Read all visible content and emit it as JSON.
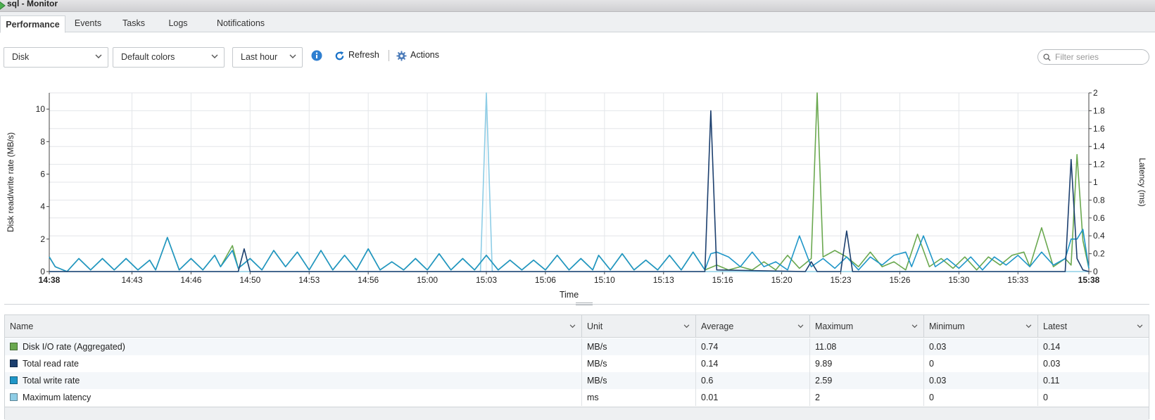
{
  "window": {
    "title": "sql - Monitor"
  },
  "tabs": [
    {
      "label": "Performance",
      "active": true
    },
    {
      "label": "Events"
    },
    {
      "label": "Tasks"
    },
    {
      "label": "Logs"
    },
    {
      "label": "Notifications"
    }
  ],
  "toolbar": {
    "metric_select": "Disk",
    "colors_select": "Default colors",
    "range_select": "Last hour",
    "refresh_label": "Refresh",
    "actions_label": "Actions",
    "filter_placeholder": "Filter series"
  },
  "colors": {
    "disk_io": "#6aa84f",
    "read": "#1c3f6e",
    "write": "#1f96c8",
    "latency": "#8ecde6",
    "accent": "#1a73c9"
  },
  "chart_data": {
    "type": "line",
    "xlabel": "Time",
    "ylabel_left": "Disk read/write rate (MB/s)",
    "ylabel_right": "Latency (ms)",
    "x_range_minutes": [
      0,
      60
    ],
    "y_left_range": [
      0,
      11
    ],
    "y_right_range": [
      0,
      2
    ],
    "y_left_ticks": [
      "0",
      "2",
      "4",
      "6",
      "8",
      "10"
    ],
    "y_right_ticks": [
      "0",
      "0.2",
      "0.4",
      "0.6",
      "0.8",
      "1",
      "1.2",
      "1.4",
      "1.6",
      "1.8",
      "2"
    ],
    "x_ticks": [
      {
        "t": 0,
        "label": "14:38",
        "bold": true
      },
      {
        "t": 7,
        "label": "14:43"
      },
      {
        "t": 12,
        "label": "14:46"
      },
      {
        "t": 17,
        "label": "14:50"
      },
      {
        "t": 22,
        "label": "14:53"
      },
      {
        "t": 27,
        "label": "14:56"
      },
      {
        "t": 32,
        "label": "15:00"
      },
      {
        "t": 37,
        "label": "15:03"
      },
      {
        "t": 42,
        "label": "15:06"
      },
      {
        "t": 47,
        "label": "15:10"
      },
      {
        "t": 52,
        "label": "15:13"
      },
      {
        "t": 57,
        "label": "15:16"
      },
      {
        "t": 62,
        "label": "15:20"
      },
      {
        "t": 67,
        "label": "15:23"
      },
      {
        "t": 72,
        "label": "15:26"
      },
      {
        "t": 77,
        "label": "15:30"
      },
      {
        "t": 82,
        "label": "15:33"
      },
      {
        "t": 88,
        "label": "15:38",
        "bold": true
      }
    ],
    "x_max": 88,
    "series": [
      {
        "name": "Disk I/O rate (Aggregated)",
        "axis": "left",
        "color_key": "disk_io",
        "points": [
          [
            0,
            0.9
          ],
          [
            0.5,
            0.3
          ],
          [
            1.5,
            0
          ],
          [
            2.5,
            0.8
          ],
          [
            3.5,
            0.1
          ],
          [
            4.5,
            0.8
          ],
          [
            5.5,
            0.1
          ],
          [
            6.5,
            0.8
          ],
          [
            7.5,
            0.1
          ],
          [
            8.5,
            0.7
          ],
          [
            9,
            0.1
          ],
          [
            10,
            2.1
          ],
          [
            11,
            0.1
          ],
          [
            12,
            0.8
          ],
          [
            13,
            0.1
          ],
          [
            14,
            1.0
          ],
          [
            14.5,
            0.3
          ],
          [
            15.5,
            1.6
          ],
          [
            16,
            0.2
          ],
          [
            17,
            0.8
          ],
          [
            18,
            0.1
          ],
          [
            19,
            1.3
          ],
          [
            20,
            0.3
          ],
          [
            21,
            1.2
          ],
          [
            22,
            0.1
          ],
          [
            23,
            1.3
          ],
          [
            24,
            0.1
          ],
          [
            25,
            1.0
          ],
          [
            26,
            0.1
          ],
          [
            27,
            1.4
          ],
          [
            28,
            0.1
          ],
          [
            29,
            0.6
          ],
          [
            30,
            0.1
          ],
          [
            31,
            0.8
          ],
          [
            32,
            0.1
          ],
          [
            33,
            1.1
          ],
          [
            34,
            0.1
          ],
          [
            35,
            0.8
          ],
          [
            36,
            0.1
          ],
          [
            37,
            1.0
          ],
          [
            38,
            0.1
          ],
          [
            39,
            0.7
          ],
          [
            40,
            0.1
          ],
          [
            41,
            0.7
          ],
          [
            42,
            0.1
          ],
          [
            43,
            1.0
          ],
          [
            44,
            0.1
          ],
          [
            45,
            0.8
          ],
          [
            46,
            0.1
          ],
          [
            46.5,
            1.0
          ],
          [
            47.5,
            0.1
          ],
          [
            48.5,
            1.1
          ],
          [
            49.5,
            0.1
          ],
          [
            50.5,
            0.7
          ],
          [
            51.5,
            0.1
          ],
          [
            52.5,
            1.0
          ],
          [
            53.5,
            0.1
          ],
          [
            54.5,
            1.2
          ],
          [
            55.5,
            0.1
          ],
          [
            56.5,
            0.4
          ],
          [
            57.5,
            0.1
          ],
          [
            58.5,
            0.3
          ],
          [
            59.5,
            0.1
          ],
          [
            60.5,
            0.6
          ],
          [
            61.5,
            0.1
          ],
          [
            62.5,
            1.0
          ],
          [
            63.5,
            0.2
          ],
          [
            64.5,
            0.8
          ],
          [
            65,
            11.1
          ],
          [
            65.5,
            0.9
          ],
          [
            66.5,
            1.3
          ],
          [
            67.5,
            0.9
          ],
          [
            68.5,
            0.3
          ],
          [
            69.5,
            1.2
          ],
          [
            70.5,
            0.3
          ],
          [
            71.5,
            0.6
          ],
          [
            72.5,
            0.1
          ],
          [
            73.5,
            2.3
          ],
          [
            74.5,
            0.3
          ],
          [
            75.5,
            0.8
          ],
          [
            76.5,
            0.2
          ],
          [
            77.5,
            0.9
          ],
          [
            78.5,
            0.1
          ],
          [
            79.5,
            0.9
          ],
          [
            80.5,
            0.4
          ],
          [
            81.5,
            1.0
          ],
          [
            82.5,
            1.2
          ],
          [
            83,
            0.3
          ],
          [
            84,
            2.7
          ],
          [
            85,
            0.3
          ],
          [
            86,
            0.8
          ],
          [
            86.5,
            0.4
          ],
          [
            87,
            7.2
          ],
          [
            87.5,
            1.9
          ],
          [
            88,
            0.2
          ]
        ]
      },
      {
        "name": "Total read rate",
        "axis": "left",
        "color_key": "read",
        "points": [
          [
            0,
            0
          ],
          [
            16,
            0
          ],
          [
            16.5,
            1.4
          ],
          [
            17,
            0
          ],
          [
            55.5,
            0
          ],
          [
            56,
            9.9
          ],
          [
            56.5,
            0.1
          ],
          [
            64,
            0
          ],
          [
            64.5,
            0.6
          ],
          [
            65,
            0
          ],
          [
            67,
            0
          ],
          [
            67.5,
            2.5
          ],
          [
            68,
            0
          ],
          [
            86,
            0
          ],
          [
            86.5,
            6.9
          ],
          [
            87,
            0.8
          ],
          [
            87.5,
            0.1
          ],
          [
            88,
            0
          ]
        ]
      },
      {
        "name": "Total write rate",
        "axis": "left",
        "color_key": "write",
        "points": [
          [
            0,
            0.9
          ],
          [
            0.5,
            0.3
          ],
          [
            1.5,
            0
          ],
          [
            2.5,
            0.8
          ],
          [
            3.5,
            0.1
          ],
          [
            4.5,
            0.8
          ],
          [
            5.5,
            0.1
          ],
          [
            6.5,
            0.8
          ],
          [
            7.5,
            0.1
          ],
          [
            8.5,
            0.7
          ],
          [
            9,
            0.1
          ],
          [
            10,
            2.1
          ],
          [
            11,
            0.1
          ],
          [
            12,
            0.8
          ],
          [
            13,
            0.1
          ],
          [
            14,
            1.0
          ],
          [
            14.5,
            0.3
          ],
          [
            15.5,
            1.3
          ],
          [
            16,
            0.2
          ],
          [
            17,
            0.8
          ],
          [
            18,
            0.1
          ],
          [
            19,
            1.3
          ],
          [
            20,
            0.3
          ],
          [
            21,
            1.2
          ],
          [
            22,
            0.1
          ],
          [
            23,
            1.3
          ],
          [
            24,
            0.1
          ],
          [
            25,
            1.0
          ],
          [
            26,
            0.1
          ],
          [
            27,
            1.4
          ],
          [
            28,
            0.1
          ],
          [
            29,
            0.6
          ],
          [
            30,
            0.1
          ],
          [
            31,
            0.8
          ],
          [
            32,
            0.1
          ],
          [
            33,
            1.1
          ],
          [
            34,
            0.1
          ],
          [
            35,
            0.8
          ],
          [
            36,
            0.1
          ],
          [
            37,
            1.0
          ],
          [
            38,
            0.1
          ],
          [
            39,
            0.7
          ],
          [
            40,
            0.1
          ],
          [
            41,
            0.7
          ],
          [
            42,
            0.1
          ],
          [
            43,
            1.0
          ],
          [
            44,
            0.1
          ],
          [
            45,
            0.8
          ],
          [
            46,
            0.1
          ],
          [
            46.5,
            1.0
          ],
          [
            47.5,
            0.1
          ],
          [
            48.5,
            1.1
          ],
          [
            49.5,
            0.1
          ],
          [
            50.5,
            0.7
          ],
          [
            51.5,
            0.1
          ],
          [
            52.5,
            1.0
          ],
          [
            53.5,
            0.1
          ],
          [
            54.5,
            1.2
          ],
          [
            55.5,
            0.1
          ],
          [
            56,
            1.1
          ],
          [
            56.5,
            1.2
          ],
          [
            57.5,
            0.9
          ],
          [
            58.5,
            0.3
          ],
          [
            59.5,
            1.2
          ],
          [
            60.5,
            0.3
          ],
          [
            61.5,
            0.6
          ],
          [
            62.5,
            0.1
          ],
          [
            63.5,
            2.2
          ],
          [
            64.5,
            0.3
          ],
          [
            65.5,
            0.8
          ],
          [
            66.5,
            0.2
          ],
          [
            67.5,
            0.9
          ],
          [
            68.5,
            0.1
          ],
          [
            69.5,
            0.9
          ],
          [
            70.5,
            0.4
          ],
          [
            71.5,
            1.0
          ],
          [
            72.5,
            1.2
          ],
          [
            73,
            0.3
          ],
          [
            74,
            2.2
          ],
          [
            75,
            0.3
          ],
          [
            76,
            0.8
          ],
          [
            77,
            0.2
          ],
          [
            78,
            0.9
          ],
          [
            79,
            0.1
          ],
          [
            80,
            0.9
          ],
          [
            81,
            0.4
          ],
          [
            82,
            1.0
          ],
          [
            83,
            0.3
          ],
          [
            84,
            1.2
          ],
          [
            85,
            0.4
          ],
          [
            86,
            0.8
          ],
          [
            86.5,
            2.0
          ],
          [
            87,
            2.0
          ],
          [
            87.5,
            2.6
          ],
          [
            88,
            0.2
          ]
        ]
      },
      {
        "name": "Maximum latency",
        "axis": "right",
        "color_key": "latency",
        "points": [
          [
            0,
            0
          ],
          [
            36.5,
            0
          ],
          [
            37,
            2
          ],
          [
            37.5,
            0
          ],
          [
            88,
            0
          ]
        ]
      }
    ]
  },
  "table": {
    "columns": [
      "Name",
      "Unit",
      "Average",
      "Maximum",
      "Minimum",
      "Latest"
    ],
    "rows": [
      {
        "name": "Disk I/O rate (Aggregated)",
        "color": "#6aa84f",
        "unit": "MB/s",
        "average": "0.74",
        "maximum": "11.08",
        "minimum": "0.03",
        "latest": "0.14"
      },
      {
        "name": "Total read rate",
        "color": "#1c3f6e",
        "unit": "MB/s",
        "average": "0.14",
        "maximum": "9.89",
        "minimum": "0",
        "latest": "0.03"
      },
      {
        "name": "Total write rate",
        "color": "#1f96c8",
        "unit": "MB/s",
        "average": "0.6",
        "maximum": "2.59",
        "minimum": "0.03",
        "latest": "0.11"
      },
      {
        "name": "Maximum latency",
        "color": "#8ecde6",
        "unit": "ms",
        "average": "0.01",
        "maximum": "2",
        "minimum": "0",
        "latest": "0"
      }
    ]
  }
}
